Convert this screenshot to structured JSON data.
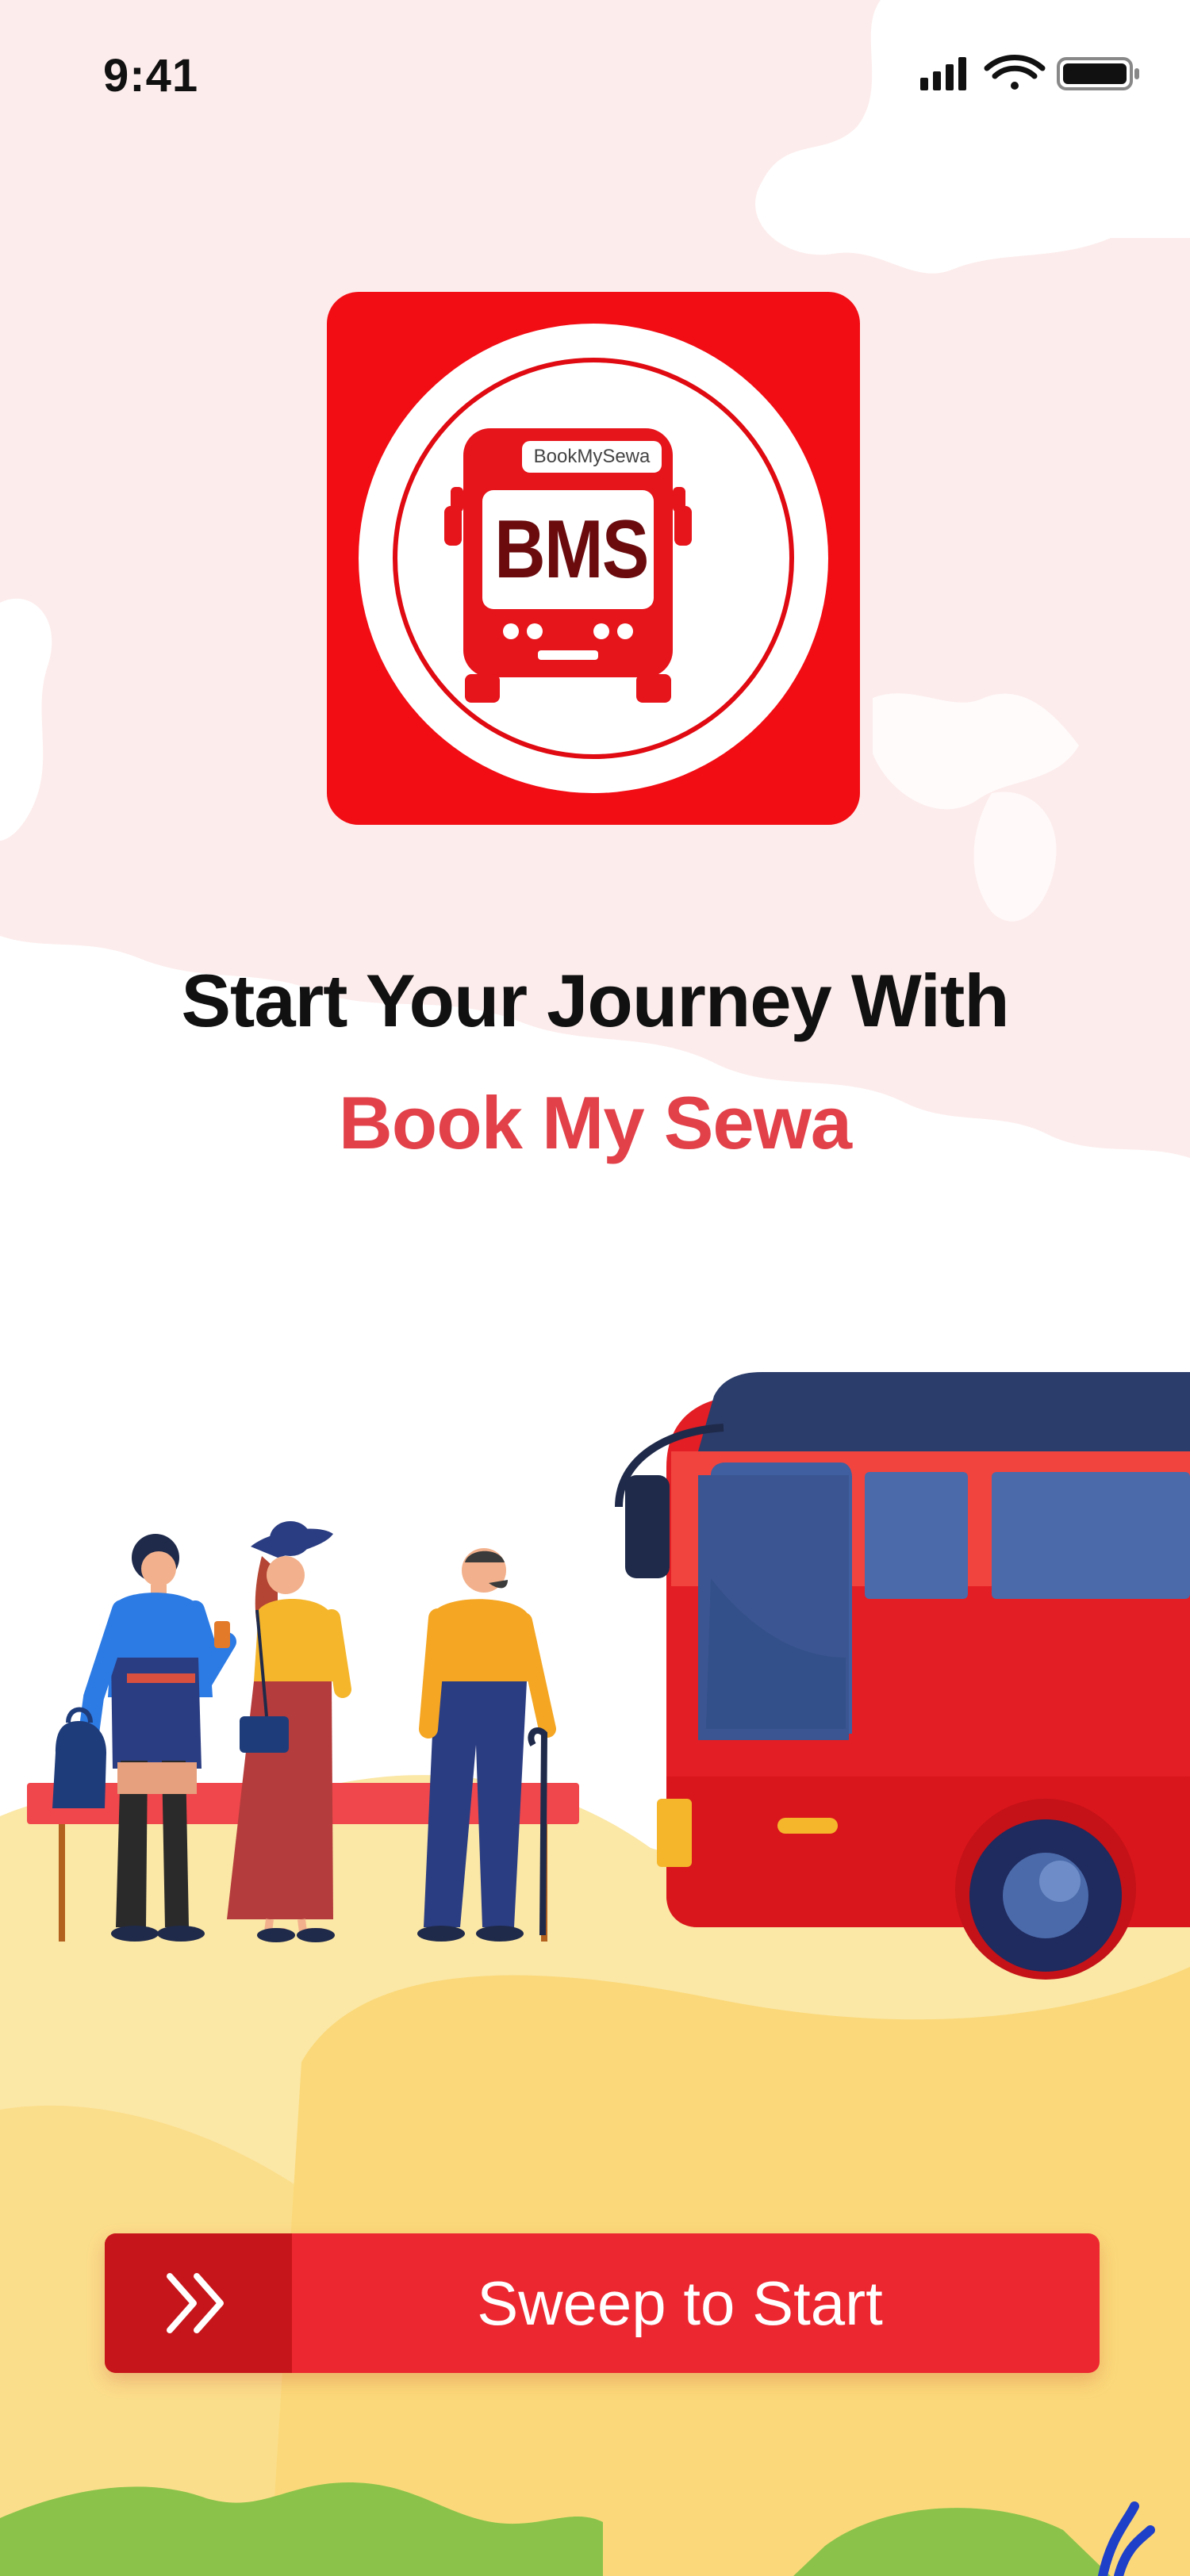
{
  "status_bar": {
    "time": "9:41",
    "icons": [
      "signal-icon",
      "wifi-icon",
      "battery-icon"
    ]
  },
  "logo": {
    "badge_text": "BookMySewa",
    "abbr": "BMS"
  },
  "headline": "Start Your Journey With",
  "brand_name": "Book My Sewa",
  "cta": {
    "label": "Sweep to Start",
    "handle_icon": "double-chevron-right-icon"
  },
  "colors": {
    "brand_red": "#E2414A",
    "logo_red": "#F20D14",
    "button_red": "#EC2730",
    "button_handle": "#C7161B",
    "ground_yellow": "#FBE39A"
  }
}
